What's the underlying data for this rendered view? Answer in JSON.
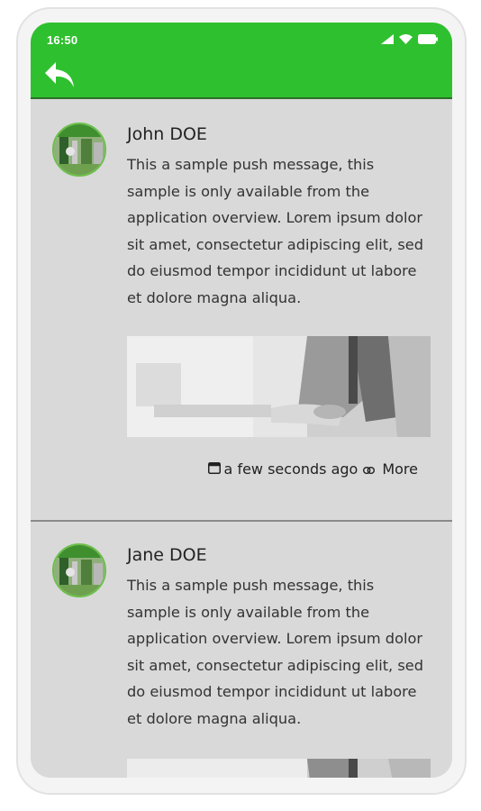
{
  "status_bar": {
    "time": "16:50"
  },
  "icons": {
    "back": "reply-arrow-icon",
    "signal": "signal-icon",
    "wifi": "wifi-icon",
    "battery": "battery-icon",
    "calendar": "calendar-icon",
    "link": "link-icon"
  },
  "colors": {
    "app_bar": "#2fc02f",
    "background": "#d9d9d9"
  },
  "messages": [
    {
      "name": "John DOE",
      "text": "This a sample push message, this sample is only available from the application overview. Lorem ipsum dolor sit amet, consectetur adipiscing elit, sed do eiusmod tempor incididunt ut labore et dolore magna aliqua.",
      "time": "a few seconds ago",
      "more_label": "More"
    },
    {
      "name": "Jane DOE",
      "text": "This a sample push message, this sample is only available from the application overview. Lorem ipsum dolor sit amet, consectetur adipiscing elit, sed do eiusmod tempor incididunt ut labore et dolore magna aliqua."
    }
  ]
}
